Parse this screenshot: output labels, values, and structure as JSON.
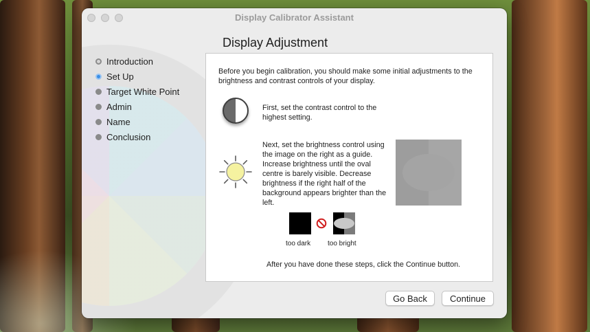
{
  "window": {
    "title": "Display Calibrator Assistant"
  },
  "page": {
    "heading": "Display Adjustment"
  },
  "steps": [
    {
      "label": "Introduction",
      "state": "done"
    },
    {
      "label": "Set Up",
      "state": "current"
    },
    {
      "label": "Target White Point",
      "state": "pending"
    },
    {
      "label": "Admin",
      "state": "pending"
    },
    {
      "label": "Name",
      "state": "pending"
    },
    {
      "label": "Conclusion",
      "state": "pending"
    }
  ],
  "panel": {
    "intro": "Before you begin calibration, you should make some initial adjustments to the brightness and contrast controls of your display.",
    "contrast": "First, set the contrast control to the highest setting.",
    "brightness": "Next, set the brightness control using the image on the right as a guide. Increase brightness until the oval centre is barely visible. Decrease brightness if the right half of the background appears brighter than the left.",
    "too_dark": "too dark",
    "too_bright": "too bright",
    "after": "After you have done these steps, click the Continue button."
  },
  "buttons": {
    "back": "Go Back",
    "continue": "Continue"
  },
  "icons": {
    "contrast": "contrast-half-circle-icon",
    "brightness": "sun-icon",
    "prohibited": "no-sign-icon"
  },
  "colors": {
    "current_step": "#3a8ee6",
    "prohibited": "#d01f1f"
  }
}
